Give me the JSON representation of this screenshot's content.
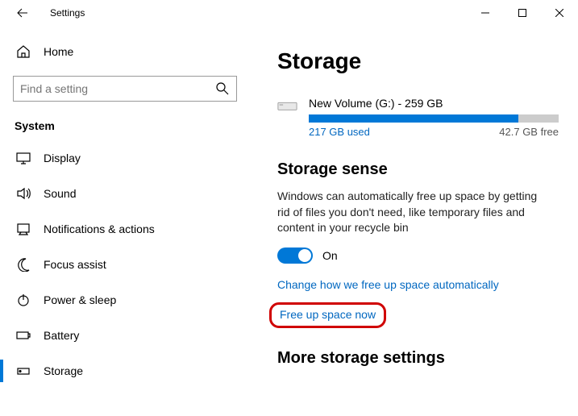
{
  "window": {
    "title": "Settings"
  },
  "sidebar": {
    "home": "Home",
    "search_placeholder": "Find a setting",
    "category": "System",
    "items": [
      {
        "label": "Display"
      },
      {
        "label": "Sound"
      },
      {
        "label": "Notifications & actions"
      },
      {
        "label": "Focus assist"
      },
      {
        "label": "Power & sleep"
      },
      {
        "label": "Battery"
      },
      {
        "label": "Storage"
      }
    ]
  },
  "main": {
    "title": "Storage",
    "drive": {
      "name": "New Volume (G:) - 259 GB",
      "used_label": "217 GB used",
      "free_label": "42.7 GB free",
      "used_pct": 84
    },
    "sense": {
      "heading": "Storage sense",
      "description": "Windows can automatically free up space by getting rid of files you don't need, like temporary files and content in your recycle bin",
      "toggle_state": "On",
      "link_change": "Change how we free up space automatically",
      "link_free": "Free up space now"
    },
    "more": {
      "heading": "More storage settings"
    }
  }
}
